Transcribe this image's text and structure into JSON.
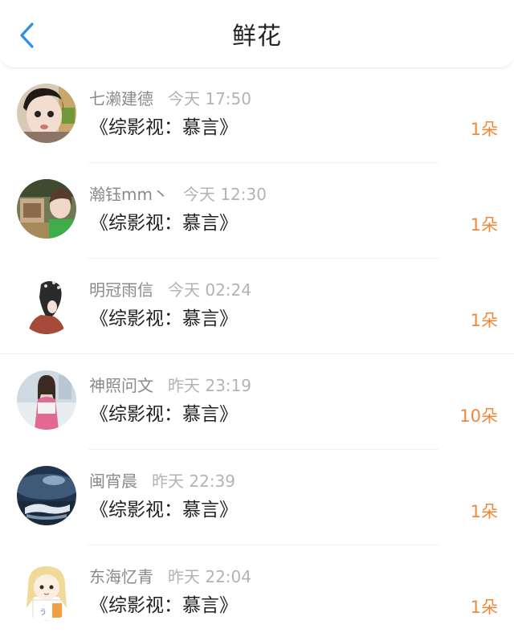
{
  "header": {
    "title": "鲜花",
    "back_icon": "chevron-left-icon",
    "accent_color": "#2a8fe8"
  },
  "colors": {
    "name_text": "#8a8a8a",
    "time_text": "#b3b3b3",
    "book_text": "#222222",
    "count_text": "#f0883a"
  },
  "items": [
    {
      "name": "七濑建德",
      "time": "今天 17:50",
      "book": "《综影视：慕言》",
      "count": "1朵"
    },
    {
      "name": "瀚钰mm丶",
      "time": "今天 12:30",
      "book": "《综影视：慕言》",
      "count": "1朵"
    },
    {
      "name": "明冠雨信",
      "time": "今天 02:24",
      "book": "《综影视：慕言》",
      "count": "1朵"
    },
    {
      "name": "神照问文",
      "time": "昨天 23:19",
      "book": "《综影视：慕言》",
      "count": "10朵"
    },
    {
      "name": "闽宵晨",
      "time": "昨天 22:39",
      "book": "《综影视：慕言》",
      "count": "1朵"
    },
    {
      "name": "东海忆青",
      "time": "昨天 22:04",
      "book": "《综影视：慕言》",
      "count": "1朵"
    }
  ]
}
